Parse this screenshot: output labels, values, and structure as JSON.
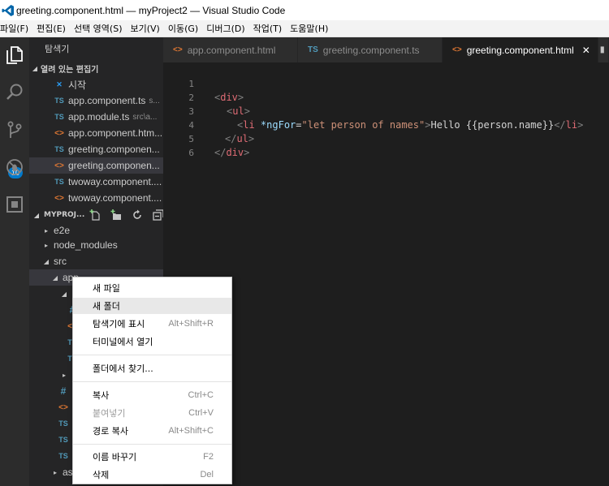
{
  "window": {
    "title": "greeting.component.html — myProject2 — Visual Studio Code"
  },
  "menubar": {
    "items": [
      "파일(F)",
      "편집(E)",
      "선택 영역(S)",
      "보기(V)",
      "이동(G)",
      "디버그(D)",
      "작업(T)",
      "도움말(H)"
    ]
  },
  "activity": {
    "scm_badge": "10"
  },
  "sidebar": {
    "title": "탐색기",
    "open_editors_header": "열려 있는 편집기",
    "open_editors": [
      {
        "icon": "vs",
        "name": "시작",
        "desc": ""
      },
      {
        "icon": "ts",
        "name": "app.component.ts",
        "desc": "s..."
      },
      {
        "icon": "ts",
        "name": "app.module.ts",
        "desc": "src\\a..."
      },
      {
        "icon": "html",
        "name": "app.component.htm...",
        "desc": ""
      },
      {
        "icon": "ts",
        "name": "greeting.componen...",
        "desc": ""
      },
      {
        "icon": "html",
        "name": "greeting.componen...",
        "desc": ""
      },
      {
        "icon": "ts",
        "name": "twoway.component....",
        "desc": ""
      },
      {
        "icon": "html",
        "name": "twoway.component....",
        "desc": ""
      }
    ],
    "project_header": "MYPROJ...",
    "tree": {
      "e2e": "e2e",
      "node_modules": "node_modules",
      "src": "src",
      "app": "app",
      "assets": "as"
    }
  },
  "tabs": [
    {
      "icon": "html",
      "label": "app.component.html",
      "active": false
    },
    {
      "icon": "ts",
      "label": "greeting.component.ts",
      "active": false
    },
    {
      "icon": "html",
      "label": "greeting.component.html",
      "active": true
    }
  ],
  "editor": {
    "line_numbers": [
      "1",
      "2",
      "3",
      "4",
      "5",
      "6"
    ],
    "lines": {
      "l1": {
        "open": "<",
        "tag": "div",
        "close": ">"
      },
      "l2": {
        "open": "<",
        "tag": "ul",
        "close": ">"
      },
      "l3": {
        "open": "<",
        "tag": "li",
        "attr": "*ngFor",
        "eq": "=",
        "val": "\"let person of names\"",
        "close": ">",
        "text": "Hello {{person.name}}",
        "endopen": "</",
        "endtag": "li",
        "endclose": ">"
      },
      "l4": {
        "open": "</",
        "tag": "ul",
        "close": ">"
      },
      "l5": {
        "open": "</",
        "tag": "div",
        "close": ">"
      }
    }
  },
  "context_menu": {
    "items": [
      {
        "label": "새 파일",
        "shortcut": ""
      },
      {
        "label": "새 폴더",
        "shortcut": ""
      },
      {
        "label": "탐색기에 표시",
        "shortcut": "Alt+Shift+R"
      },
      {
        "label": "터미널에서 열기",
        "shortcut": ""
      },
      {
        "label": "폴더에서 찾기...",
        "shortcut": ""
      },
      {
        "label": "복사",
        "shortcut": "Ctrl+C"
      },
      {
        "label": "붙여넣기",
        "shortcut": "Ctrl+V"
      },
      {
        "label": "경로 복사",
        "shortcut": "Alt+Shift+C"
      },
      {
        "label": "이름 바꾸기",
        "shortcut": "F2"
      },
      {
        "label": "삭제",
        "shortcut": "Del"
      }
    ]
  },
  "colors": {
    "accent": "#007acc",
    "editor_bg": "#1e1e1e",
    "sidebar_bg": "#252526",
    "activity_bg": "#2c2c2c",
    "tag": "#569cd6",
    "attr": "#9cdcfe",
    "string": "#ce9178"
  }
}
